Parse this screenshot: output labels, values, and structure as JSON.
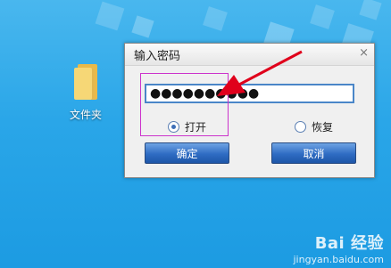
{
  "desktop": {
    "folder_label": "文件夹"
  },
  "dialog": {
    "title": "输入密码",
    "close_glyph": "×",
    "password_masked": "●●●●●●●●●●",
    "options": {
      "open_label": "打开",
      "restore_label": "恢复"
    },
    "buttons": {
      "ok_label": "确定",
      "cancel_label": "取消"
    }
  },
  "watermark": {
    "brand": "Bai 经验",
    "url": "jingyan.baidu.com"
  },
  "colors": {
    "desktop_bg": "#2aa6e8",
    "button_blue": "#2f6cc3",
    "highlight": "#cc33cc",
    "arrow": "#e0001b"
  }
}
